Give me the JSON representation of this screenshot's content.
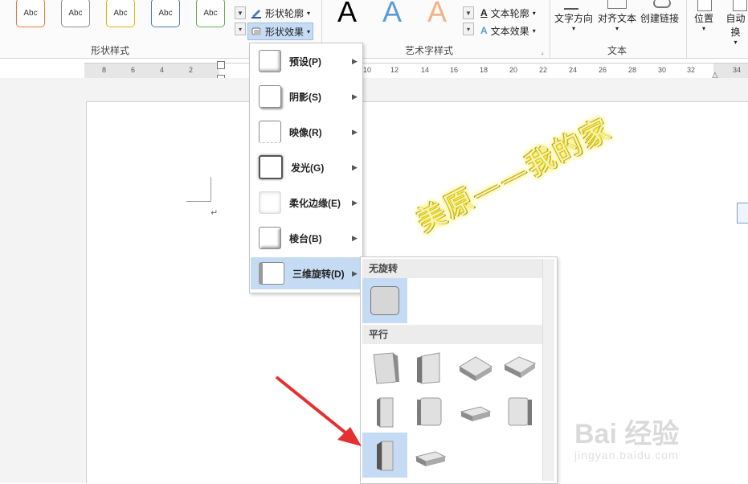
{
  "ribbon": {
    "shape_styles": {
      "group_label": "形状样式",
      "tiles": [
        "Abc",
        "Abc",
        "Abc",
        "Abc",
        "Abc"
      ],
      "tile_colors": [
        "#e8783a",
        "#8e8e8e",
        "#e2b600",
        "#4f7bb8",
        "#6aa84f"
      ],
      "outline_label": "形状轮廓",
      "effects_label": "形状效果"
    },
    "wordart_styles": {
      "group_label": "艺术字样式",
      "letters": [
        "A",
        "A",
        "A"
      ],
      "text_outline_label": "文本轮廓",
      "text_effects_label": "文本效果"
    },
    "text_group": {
      "group_label": "文本",
      "direction_label": "文字方向",
      "align_label": "对齐文本",
      "link_label": "创建链接"
    },
    "arrange": {
      "position_label": "位置",
      "wrap_label": "自动换"
    }
  },
  "ruler": {
    "ticks": [
      "8",
      "6",
      "4",
      "2",
      "10",
      "12",
      "14",
      "16",
      "18",
      "20",
      "22",
      "24",
      "26",
      "28",
      "30",
      "32",
      "34"
    ]
  },
  "document": {
    "wordart_text": "美原——我的家",
    "paragraph_mark": "↵"
  },
  "shape_effects_menu": {
    "items": [
      {
        "label": "预设(P)"
      },
      {
        "label": "阴影(S)"
      },
      {
        "label": "映像(R)"
      },
      {
        "label": "发光(G)"
      },
      {
        "label": "柔化边缘(E)"
      },
      {
        "label": "棱台(B)"
      },
      {
        "label": "三维旋转(D)"
      }
    ],
    "active_index": 6
  },
  "rotation_submenu": {
    "no_rotation_header": "无旋转",
    "parallel_header": "平行"
  },
  "watermark": {
    "brand": "Bai 经验",
    "url": "jingyan.baidu.com"
  }
}
